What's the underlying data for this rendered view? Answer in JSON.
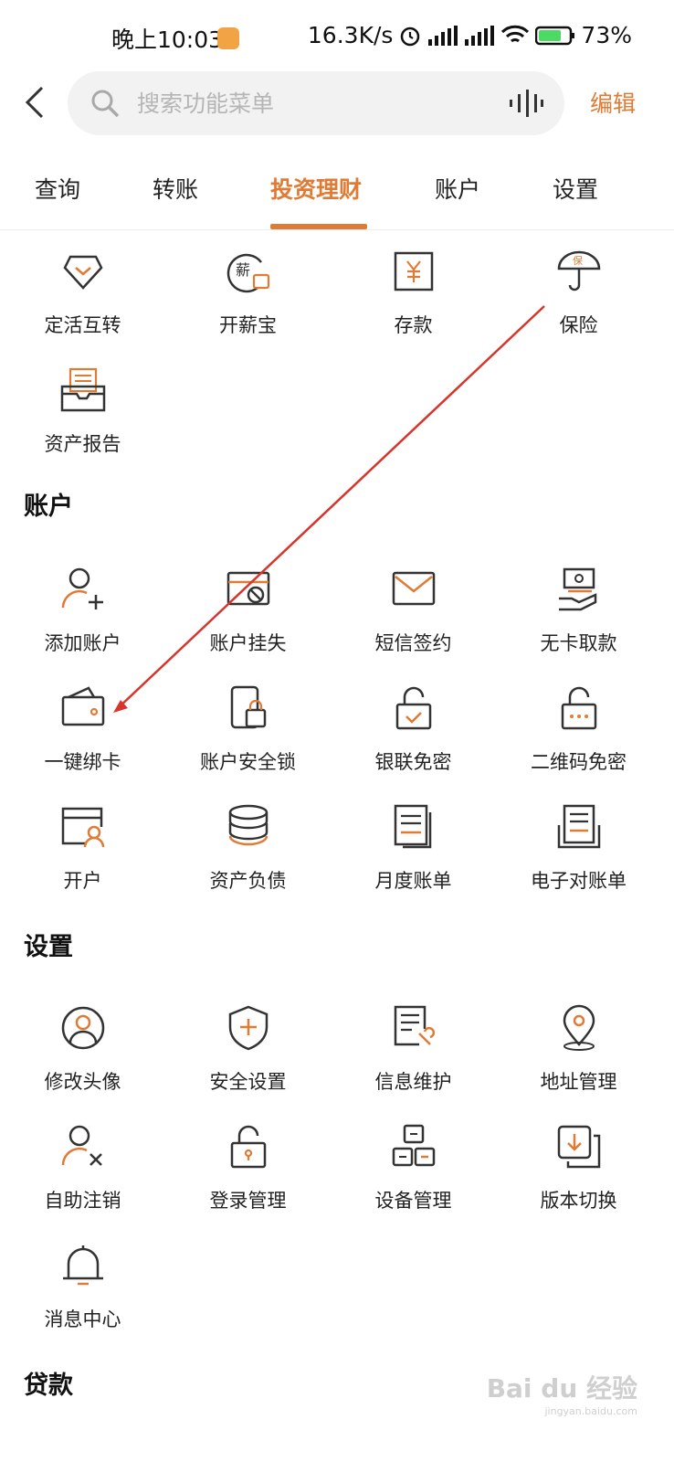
{
  "status_bar": {
    "time": "晚上10:03",
    "network_speed": "16.3K/s",
    "battery": "73%"
  },
  "header": {
    "search_placeholder": "搜索功能菜单",
    "edit_label": "编辑"
  },
  "tabs": [
    {
      "label": "查询"
    },
    {
      "label": "转账"
    },
    {
      "label": "投资理财"
    },
    {
      "label": "账户"
    },
    {
      "label": "设置"
    }
  ],
  "active_tab": "投资理财",
  "accent_color": "#e07b35",
  "invest": {
    "items": [
      {
        "label": "定活互转",
        "icon": "diamond-icon"
      },
      {
        "label": "开薪宝",
        "icon": "salary-icon"
      },
      {
        "label": "存款",
        "icon": "yuan-icon"
      },
      {
        "label": "保险",
        "icon": "umbrella-icon"
      },
      {
        "label": "资产报告",
        "icon": "report-icon"
      }
    ]
  },
  "account": {
    "title": "账户",
    "items": [
      {
        "label": "添加账户",
        "icon": "add-user-icon"
      },
      {
        "label": "账户挂失",
        "icon": "card-lost-icon"
      },
      {
        "label": "短信签约",
        "icon": "envelope-icon"
      },
      {
        "label": "无卡取款",
        "icon": "cash-hand-icon"
      },
      {
        "label": "一键绑卡",
        "icon": "wallet-icon"
      },
      {
        "label": "账户安全锁",
        "icon": "phone-lock-icon"
      },
      {
        "label": "银联免密",
        "icon": "unlock-check-icon"
      },
      {
        "label": "二维码免密",
        "icon": "unlock-dots-icon"
      },
      {
        "label": "开户",
        "icon": "open-account-icon"
      },
      {
        "label": "资产负债",
        "icon": "database-icon"
      },
      {
        "label": "月度账单",
        "icon": "bill-icon"
      },
      {
        "label": "电子对账单",
        "icon": "statement-icon"
      }
    ]
  },
  "settings": {
    "title": "设置",
    "items": [
      {
        "label": "修改头像",
        "icon": "avatar-icon"
      },
      {
        "label": "安全设置",
        "icon": "shield-plus-icon"
      },
      {
        "label": "信息维护",
        "icon": "doc-wrench-icon"
      },
      {
        "label": "地址管理",
        "icon": "location-icon"
      },
      {
        "label": "自助注销",
        "icon": "user-x-icon"
      },
      {
        "label": "登录管理",
        "icon": "padlock-icon"
      },
      {
        "label": "设备管理",
        "icon": "devices-icon"
      },
      {
        "label": "版本切换",
        "icon": "download-icon"
      },
      {
        "label": "消息中心",
        "icon": "bell-icon"
      }
    ]
  },
  "loan": {
    "title": "贷款"
  },
  "watermark": {
    "text": "Bai du 经验",
    "sub": "jingyan.baidu.com"
  }
}
